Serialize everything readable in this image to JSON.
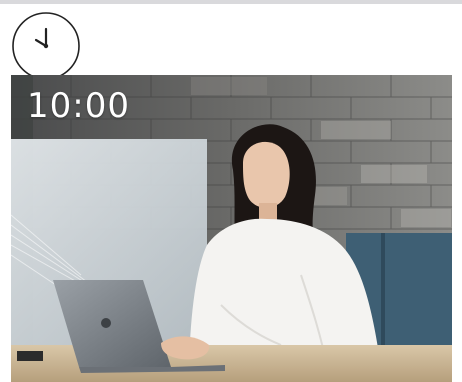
{
  "time_display": "10:00",
  "icons": {
    "clock": "clock-icon"
  },
  "image": {
    "subject": "photo-woman-working-on-laptop"
  },
  "colors": {
    "clock_stroke": "#222222",
    "time_text": "#ffffff",
    "top_bar": "#d9d9dc"
  }
}
